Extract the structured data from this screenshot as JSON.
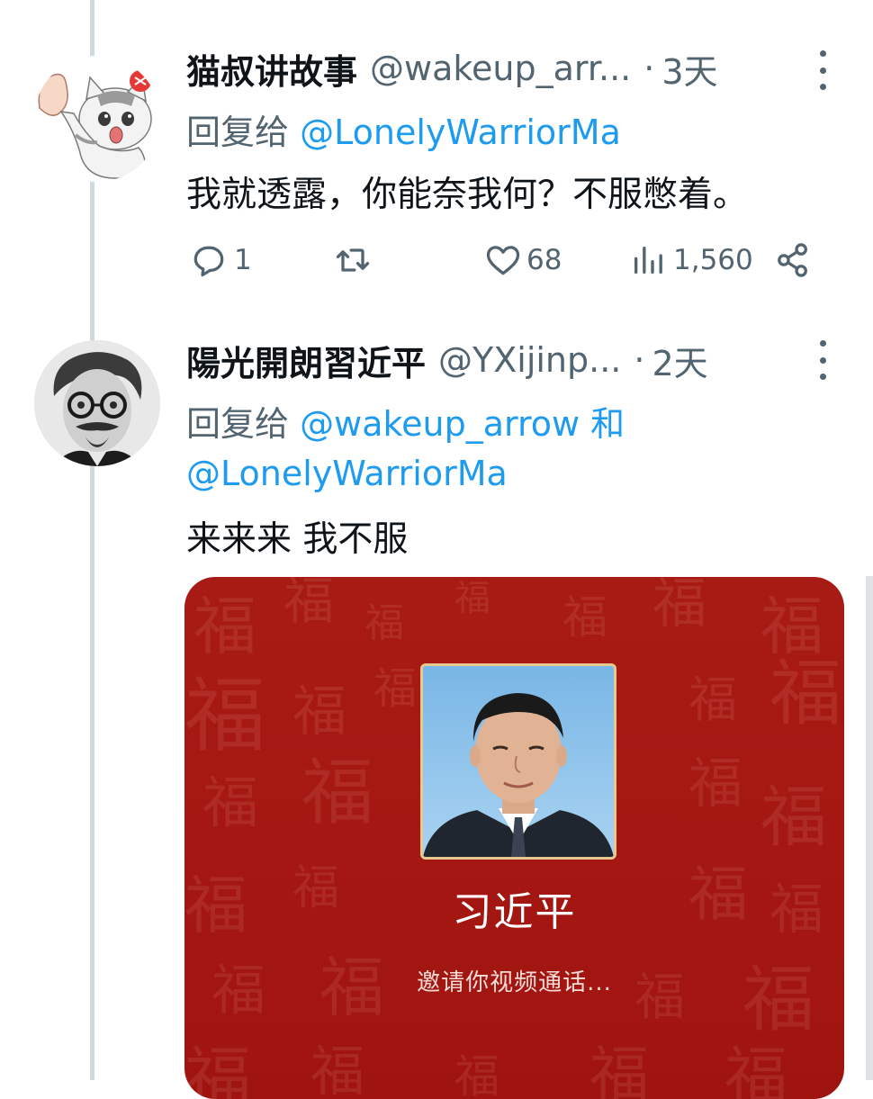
{
  "tweets": [
    {
      "display_name": "猫叔讲故事",
      "handle": "@wakeup_arr...",
      "separator": "·",
      "time": "3天",
      "reply_prefix": "回复给",
      "reply_mention": "@LonelyWarriorMa",
      "text": "我就透露，你能奈我何？不服憋着。",
      "actions": {
        "replies": "1",
        "retweets": "",
        "likes": "68",
        "views": "1,560"
      }
    },
    {
      "display_name": "陽光開朗習近平",
      "handle": "@YXijinp...",
      "separator": "·",
      "time": "2天",
      "reply_prefix": "回复给",
      "reply_mention_1": "@wakeup_arrow",
      "reply_conjunction": "和",
      "reply_mention_2": "@LonelyWarriorMa",
      "text": "来来来 我不服",
      "media": {
        "caller_name": "习近平",
        "caller_status": "邀请你视频通话...",
        "background_color": "#a51712",
        "watermark_char": "福"
      }
    }
  ],
  "colors": {
    "text": "#0f1419",
    "secondary": "#536471",
    "link": "#1d9bf0",
    "thread_line": "#cfd9de"
  },
  "icons": [
    "reply-icon",
    "retweet-icon",
    "like-icon",
    "views-icon",
    "share-icon",
    "more-icon"
  ]
}
